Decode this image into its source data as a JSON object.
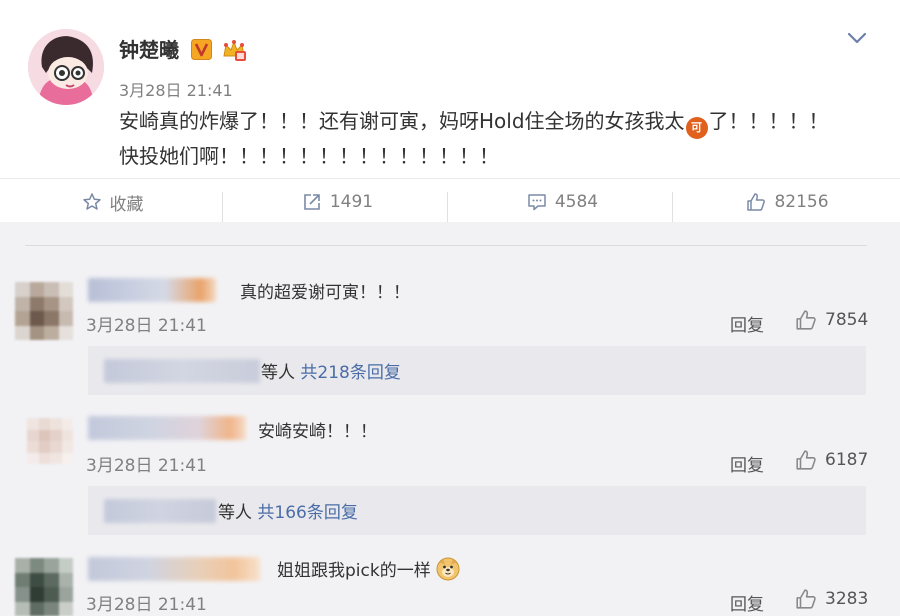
{
  "post": {
    "username": "钟楚曦",
    "time": "3月28日 21:41",
    "text_line1_before": "安崎真的炸爆了！！！还有谢可寅，妈呀Hold住全场的女孩我太",
    "text_emoji_label": "可",
    "text_line1_after": "了！！！！！",
    "text_line2": "快投她们啊！！！！！！！！！！！！！！",
    "actions": {
      "favorite_label": "收藏",
      "repost_count": "1491",
      "comment_count": "4584",
      "like_count": "82156"
    }
  },
  "comments": [
    {
      "text": "真的超爱谢可寅！！！",
      "time": "3月28日 21:41",
      "reply_label": "回复",
      "likes": "7854",
      "sub_suffix": "等人",
      "sub_link": "共218条回复"
    },
    {
      "text": "安崎安崎！！！",
      "time": "3月28日 21:41",
      "reply_label": "回复",
      "likes": "6187",
      "sub_suffix": "等人",
      "sub_link": "共166条回复"
    },
    {
      "text": "姐姐跟我pick的一样",
      "time": "3月28日 21:41",
      "reply_label": "回复",
      "likes": "3283"
    }
  ],
  "icons": {
    "verified": "verified-v-icon",
    "crown": "vip-crown-icon",
    "chevron": "chevron-down-icon",
    "favorite": "star-icon",
    "repost": "share-icon",
    "comment": "comment-icon",
    "like": "thumbs-up-icon",
    "doge": "doge-emoji-icon"
  },
  "colors": {
    "link": "#4a6da8",
    "verified_badge": "#f5a623",
    "emoji_orange": "#e0601e"
  }
}
